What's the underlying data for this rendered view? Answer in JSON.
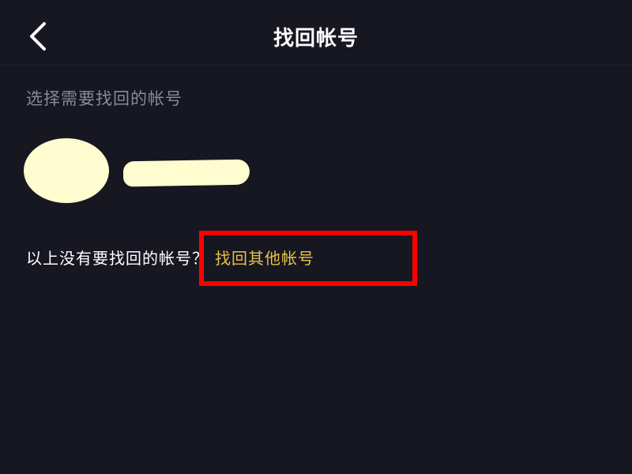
{
  "header": {
    "title": "找回帐号",
    "back_icon": "chevron-left-icon"
  },
  "section": {
    "label": "选择需要找回的帐号"
  },
  "accounts": [
    {
      "avatar": "redacted",
      "name": "redacted"
    }
  ],
  "footer": {
    "question": "以上没有要找回的帐号？",
    "link_label": "找回其他帐号"
  },
  "colors": {
    "background": "#171722",
    "title": "#ffffff",
    "secondary_text": "#8a8a93",
    "link": "#e6c347",
    "redaction": "#fffccf",
    "highlight": "#ff0000"
  }
}
